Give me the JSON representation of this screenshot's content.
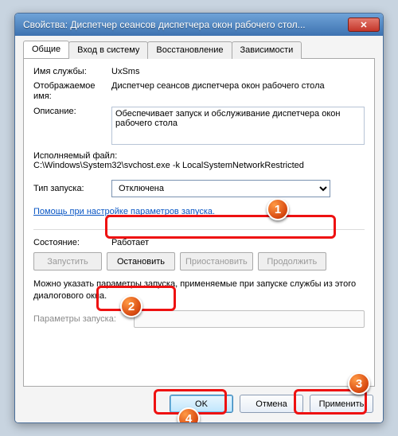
{
  "window": {
    "title": "Свойства: Диспетчер сеансов диспетчера окон рабочего стол..."
  },
  "tabs": {
    "general": "Общие",
    "logon": "Вход в систему",
    "recovery": "Восстановление",
    "dependencies": "Зависимости"
  },
  "labels": {
    "service_name": "Имя службы:",
    "display_name": "Отображаемое имя:",
    "description": "Описание:",
    "exe_path": "Исполняемый файл:",
    "startup_type": "Тип запуска:",
    "help_link": "Помощь при настройке параметров запуска.",
    "status": "Состояние:",
    "note": "Можно указать параметры запуска, применяемые при запуске службы из этого диалогового окна.",
    "start_params": "Параметры запуска:"
  },
  "values": {
    "service_name": "UxSms",
    "display_name": "Диспетчер сеансов диспетчера окон рабочего стола",
    "description": "Обеспечивает запуск и обслуживание диспетчера окон рабочего стола",
    "exe_path": "C:\\Windows\\System32\\svchost.exe -k LocalSystemNetworkRestricted",
    "startup_selected": "Отключена",
    "status": "Работает",
    "start_params": ""
  },
  "buttons": {
    "start": "Запустить",
    "stop": "Остановить",
    "pause": "Приостановить",
    "resume": "Продолжить",
    "ok": "OK",
    "cancel": "Отмена",
    "apply": "Применить"
  },
  "annotations": {
    "b1": "1",
    "b2": "2",
    "b3": "3",
    "b4": "4"
  }
}
